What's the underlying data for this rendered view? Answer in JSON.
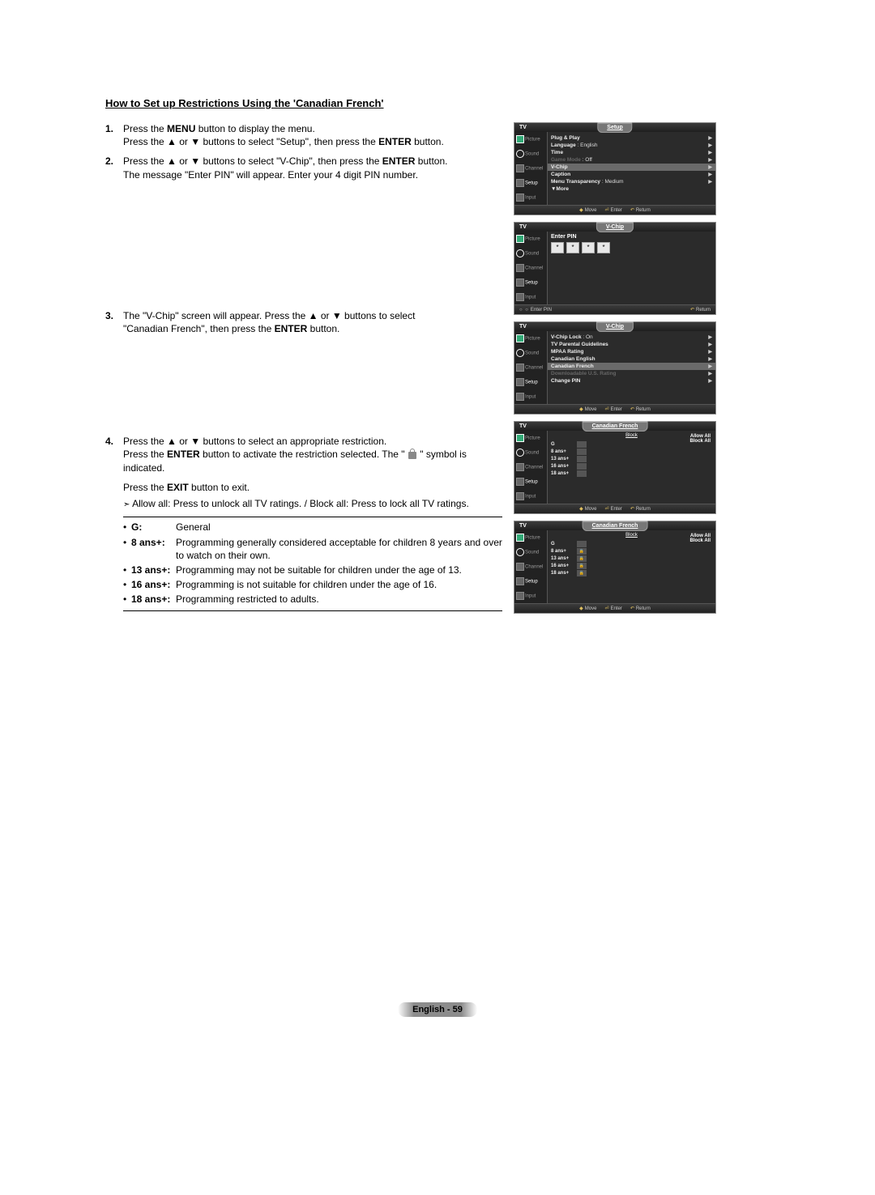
{
  "title": "How to Set up Restrictions Using the 'Canadian French'",
  "steps": {
    "s1": {
      "num": "1.",
      "l1a": "Press the ",
      "l1b": "MENU",
      "l1c": " button to display the menu.",
      "l2a": "Press the ▲ or ▼ buttons to select \"Setup\", then press the ",
      "l2b": "ENTER",
      "l2c": " button."
    },
    "s2": {
      "num": "2.",
      "l1a": "Press the ▲ or ▼ buttons to select \"V-Chip\", then press the ",
      "l1b": "ENTER",
      "l1c": " button.",
      "l2": "The message \"Enter PIN\" will appear. Enter your 4 digit PIN number."
    },
    "s3": {
      "num": "3.",
      "l1": "The \"V-Chip\" screen will appear. Press the ▲ or ▼ buttons to select",
      "l2a": "\"Canadian French\", then press the ",
      "l2b": "ENTER",
      "l2c": " button."
    },
    "s4": {
      "num": "4.",
      "l1": "Press the ▲ or ▼ buttons to select an appropriate restriction.",
      "l2a": "Press the ",
      "l2b": "ENTER",
      "l2c": " button to activate the restriction selected. The \" ",
      "l2d": " \" symbol is",
      "l3": "indicated.",
      "l4a": "Press the ",
      "l4b": "EXIT",
      "l4c": " button to exit.",
      "note": "Allow all: Press to unlock all TV ratings. / Block all: Press to lock all TV ratings."
    }
  },
  "ratings": [
    {
      "label": "G:",
      "desc": "General"
    },
    {
      "label": "8 ans+:",
      "desc": "Programming generally considered acceptable for children 8 years and over to watch on their own."
    },
    {
      "label": "13 ans+:",
      "desc": "Programming may not be suitable for children under the age of 13."
    },
    {
      "label": "16 ans+:",
      "desc": "Programming is not suitable for children under the age of 16."
    },
    {
      "label": "18 ans+:",
      "desc": "Programming restricted to adults."
    }
  ],
  "osd": {
    "side": [
      "Picture",
      "Sound",
      "Channel",
      "Setup",
      "Input"
    ],
    "s1_title": "Setup",
    "s1_items": [
      {
        "l": "Plug & Play"
      },
      {
        "l": "Language",
        "v": ": English"
      },
      {
        "l": "Time"
      },
      {
        "l": "Game Mode",
        "v": ": Off",
        "dim": true
      },
      {
        "l": "V-Chip",
        "hl": true
      },
      {
        "l": "Caption"
      },
      {
        "l": "Menu Transparency",
        "v": ": Medium"
      },
      {
        "l": "▼More"
      }
    ],
    "s2_title": "V-Chip",
    "s2_label": "Enter PIN",
    "s3_title": "V-Chip",
    "s3_items": [
      {
        "l": "V-Chip Lock",
        "v": ": On"
      },
      {
        "l": "TV Parental Guidelines"
      },
      {
        "l": "MPAA Rating"
      },
      {
        "l": "Canadian English"
      },
      {
        "l": "Canadian French",
        "hl": true
      },
      {
        "l": "Downloadable U.S. Rating",
        "dim": true
      },
      {
        "l": "Change PIN"
      }
    ],
    "s4_title": "Canadian French",
    "s4_head": "Block",
    "s4_allow": "Allow All",
    "s4_block": "Block All",
    "s4_rows": [
      "G",
      "8 ans+",
      "13 ans+",
      "16 ans+",
      "18 ans+"
    ],
    "foot_move": "Move",
    "foot_enter": "Enter",
    "foot_return": "Return",
    "foot_pin": "Enter PIN",
    "tv": "TV"
  },
  "page_num": "English - 59"
}
